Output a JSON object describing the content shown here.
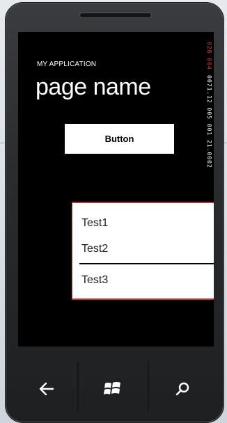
{
  "app": {
    "title": "MY APPLICATION",
    "page_name": "page name"
  },
  "button": {
    "label": "Button"
  },
  "list": {
    "items": [
      "Test1",
      "Test2",
      "Test3"
    ],
    "selected_index": 1
  },
  "frame_counters": {
    "red_line": "028 004",
    "white_line": "0071.12 005 001 21.0002"
  },
  "navbar": {
    "back_icon": "back-arrow-icon",
    "start_icon": "windows-logo-icon",
    "search_icon": "search-icon"
  },
  "colors": {
    "screen_background": "#000000",
    "accent_border": "#b23533",
    "counter_red": "#e83a2f"
  }
}
